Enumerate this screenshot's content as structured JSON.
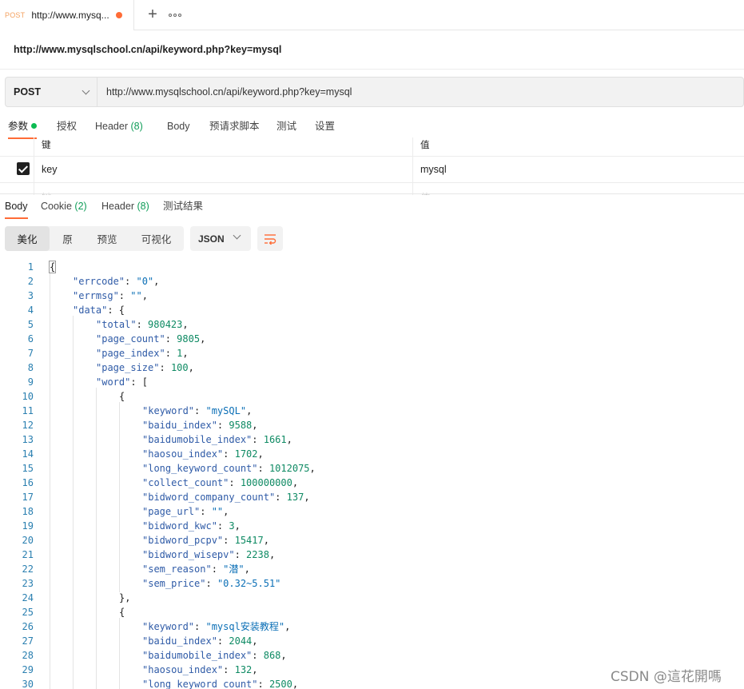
{
  "tab": {
    "method": "POST",
    "title": "http://www.mysq..."
  },
  "request": {
    "title": "http://www.mysqlschool.cn/api/keyword.php?key=mysql",
    "method": "POST",
    "url": "http://www.mysqlschool.cn/api/keyword.php?key=mysql"
  },
  "request_tabs": [
    {
      "label": "参数"
    },
    {
      "label": "授权"
    },
    {
      "label": "Header",
      "count": "(8)"
    },
    {
      "label": "Body"
    },
    {
      "label": "预请求脚本"
    },
    {
      "label": "测试"
    },
    {
      "label": "设置"
    }
  ],
  "params": {
    "key_header": "键",
    "value_header": "值",
    "rows": [
      {
        "key": "key",
        "value": "mysql",
        "checked": true
      }
    ],
    "placeholder_key": "键",
    "placeholder_value": "值"
  },
  "response_tabs": [
    {
      "label": "Body"
    },
    {
      "label": "Cookie",
      "count": "(2)"
    },
    {
      "label": "Header",
      "count": "(8)"
    },
    {
      "label": "测试结果"
    }
  ],
  "view_modes": [
    "美化",
    "原",
    "预览",
    "可视化"
  ],
  "format": "JSON",
  "code_lines": [
    {
      "n": "1",
      "indent": 0,
      "parts": [
        [
          "p",
          "{"
        ]
      ]
    },
    {
      "n": "2",
      "indent": 1,
      "parts": [
        [
          "k",
          "\"errcode\""
        ],
        [
          "p",
          ": "
        ],
        [
          "s",
          "\"0\""
        ],
        [
          "p",
          ","
        ]
      ]
    },
    {
      "n": "3",
      "indent": 1,
      "parts": [
        [
          "k",
          "\"errmsg\""
        ],
        [
          "p",
          ": "
        ],
        [
          "s",
          "\"\""
        ],
        [
          "p",
          ","
        ]
      ]
    },
    {
      "n": "4",
      "indent": 1,
      "parts": [
        [
          "k",
          "\"data\""
        ],
        [
          "p",
          ": {"
        ]
      ]
    },
    {
      "n": "5",
      "indent": 2,
      "parts": [
        [
          "k",
          "\"total\""
        ],
        [
          "p",
          ": "
        ],
        [
          "n",
          "980423"
        ],
        [
          "p",
          ","
        ]
      ]
    },
    {
      "n": "6",
      "indent": 2,
      "parts": [
        [
          "k",
          "\"page_count\""
        ],
        [
          "p",
          ": "
        ],
        [
          "n",
          "9805"
        ],
        [
          "p",
          ","
        ]
      ]
    },
    {
      "n": "7",
      "indent": 2,
      "parts": [
        [
          "k",
          "\"page_index\""
        ],
        [
          "p",
          ": "
        ],
        [
          "n",
          "1"
        ],
        [
          "p",
          ","
        ]
      ]
    },
    {
      "n": "8",
      "indent": 2,
      "parts": [
        [
          "k",
          "\"page_size\""
        ],
        [
          "p",
          ": "
        ],
        [
          "n",
          "100"
        ],
        [
          "p",
          ","
        ]
      ]
    },
    {
      "n": "9",
      "indent": 2,
      "parts": [
        [
          "k",
          "\"word\""
        ],
        [
          "p",
          ": ["
        ]
      ]
    },
    {
      "n": "10",
      "indent": 3,
      "parts": [
        [
          "p",
          "{"
        ]
      ]
    },
    {
      "n": "11",
      "indent": 4,
      "parts": [
        [
          "k",
          "\"keyword\""
        ],
        [
          "p",
          ": "
        ],
        [
          "s",
          "\"mySQL\""
        ],
        [
          "p",
          ","
        ]
      ]
    },
    {
      "n": "12",
      "indent": 4,
      "parts": [
        [
          "k",
          "\"baidu_index\""
        ],
        [
          "p",
          ": "
        ],
        [
          "n",
          "9588"
        ],
        [
          "p",
          ","
        ]
      ]
    },
    {
      "n": "13",
      "indent": 4,
      "parts": [
        [
          "k",
          "\"baidumobile_index\""
        ],
        [
          "p",
          ": "
        ],
        [
          "n",
          "1661"
        ],
        [
          "p",
          ","
        ]
      ]
    },
    {
      "n": "14",
      "indent": 4,
      "parts": [
        [
          "k",
          "\"haosou_index\""
        ],
        [
          "p",
          ": "
        ],
        [
          "n",
          "1702"
        ],
        [
          "p",
          ","
        ]
      ]
    },
    {
      "n": "15",
      "indent": 4,
      "parts": [
        [
          "k",
          "\"long_keyword_count\""
        ],
        [
          "p",
          ": "
        ],
        [
          "n",
          "1012075"
        ],
        [
          "p",
          ","
        ]
      ]
    },
    {
      "n": "16",
      "indent": 4,
      "parts": [
        [
          "k",
          "\"collect_count\""
        ],
        [
          "p",
          ": "
        ],
        [
          "n",
          "100000000"
        ],
        [
          "p",
          ","
        ]
      ]
    },
    {
      "n": "17",
      "indent": 4,
      "parts": [
        [
          "k",
          "\"bidword_company_count\""
        ],
        [
          "p",
          ": "
        ],
        [
          "n",
          "137"
        ],
        [
          "p",
          ","
        ]
      ]
    },
    {
      "n": "18",
      "indent": 4,
      "parts": [
        [
          "k",
          "\"page_url\""
        ],
        [
          "p",
          ": "
        ],
        [
          "s",
          "\"\""
        ],
        [
          "p",
          ","
        ]
      ]
    },
    {
      "n": "19",
      "indent": 4,
      "parts": [
        [
          "k",
          "\"bidword_kwc\""
        ],
        [
          "p",
          ": "
        ],
        [
          "n",
          "3"
        ],
        [
          "p",
          ","
        ]
      ]
    },
    {
      "n": "20",
      "indent": 4,
      "parts": [
        [
          "k",
          "\"bidword_pcpv\""
        ],
        [
          "p",
          ": "
        ],
        [
          "n",
          "15417"
        ],
        [
          "p",
          ","
        ]
      ]
    },
    {
      "n": "21",
      "indent": 4,
      "parts": [
        [
          "k",
          "\"bidword_wisepv\""
        ],
        [
          "p",
          ": "
        ],
        [
          "n",
          "2238"
        ],
        [
          "p",
          ","
        ]
      ]
    },
    {
      "n": "22",
      "indent": 4,
      "parts": [
        [
          "k",
          "\"sem_reason\""
        ],
        [
          "p",
          ": "
        ],
        [
          "s",
          "\"潜\""
        ],
        [
          "p",
          ","
        ]
      ]
    },
    {
      "n": "23",
      "indent": 4,
      "parts": [
        [
          "k",
          "\"sem_price\""
        ],
        [
          "p",
          ": "
        ],
        [
          "s",
          "\"0.32~5.51\""
        ]
      ]
    },
    {
      "n": "24",
      "indent": 3,
      "parts": [
        [
          "p",
          "},"
        ]
      ]
    },
    {
      "n": "25",
      "indent": 3,
      "parts": [
        [
          "p",
          "{"
        ]
      ]
    },
    {
      "n": "26",
      "indent": 4,
      "parts": [
        [
          "k",
          "\"keyword\""
        ],
        [
          "p",
          ": "
        ],
        [
          "s",
          "\"mysql安装教程\""
        ],
        [
          "p",
          ","
        ]
      ]
    },
    {
      "n": "27",
      "indent": 4,
      "parts": [
        [
          "k",
          "\"baidu_index\""
        ],
        [
          "p",
          ": "
        ],
        [
          "n",
          "2044"
        ],
        [
          "p",
          ","
        ]
      ]
    },
    {
      "n": "28",
      "indent": 4,
      "parts": [
        [
          "k",
          "\"baidumobile_index\""
        ],
        [
          "p",
          ": "
        ],
        [
          "n",
          "868"
        ],
        [
          "p",
          ","
        ]
      ]
    },
    {
      "n": "29",
      "indent": 4,
      "parts": [
        [
          "k",
          "\"haosou_index\""
        ],
        [
          "p",
          ": "
        ],
        [
          "n",
          "132"
        ],
        [
          "p",
          ","
        ]
      ]
    },
    {
      "n": "30",
      "indent": 4,
      "parts": [
        [
          "k",
          "\"long_keyword_count\""
        ],
        [
          "p",
          ": "
        ],
        [
          "n",
          "2500"
        ],
        [
          "p",
          ","
        ]
      ]
    }
  ],
  "watermark": "CSDN @這花開嗎"
}
